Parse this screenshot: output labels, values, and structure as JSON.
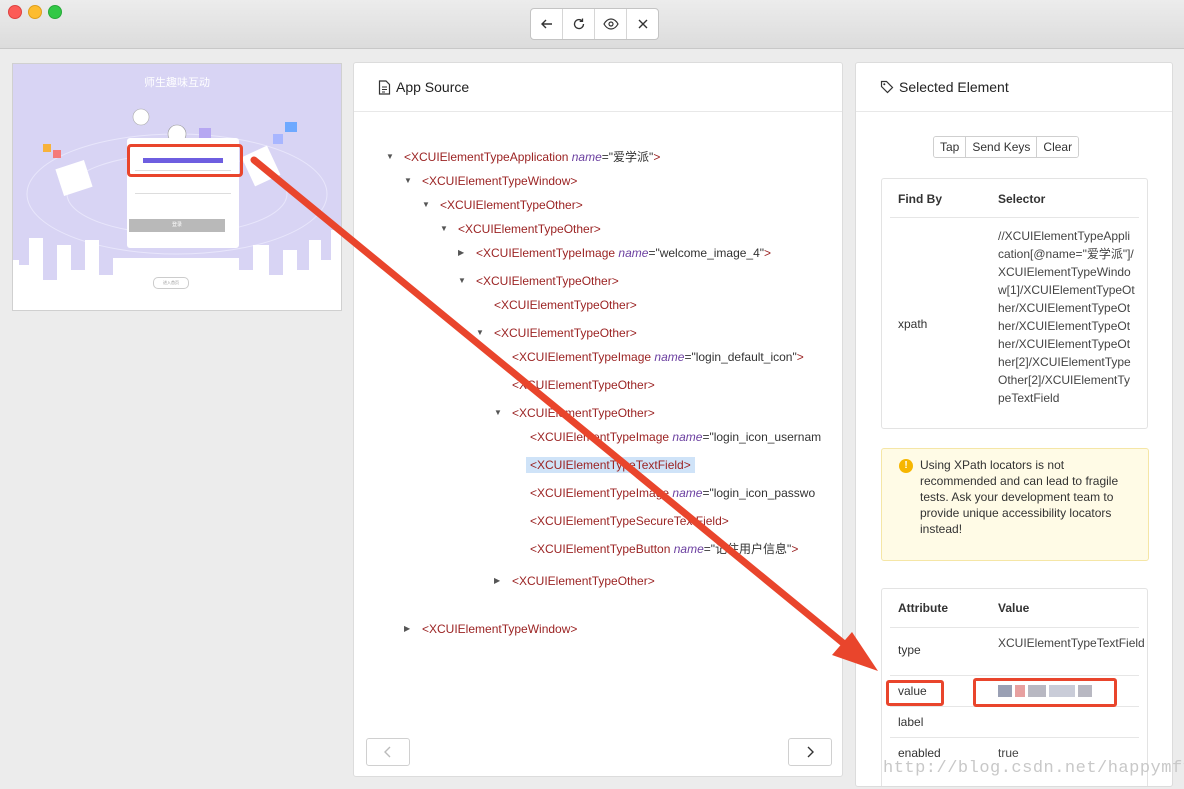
{
  "toolbar": {
    "buttons": [
      {
        "name": "back",
        "icon": "arrow-left-icon"
      },
      {
        "name": "refresh",
        "icon": "refresh-icon"
      },
      {
        "name": "inspect",
        "icon": "eye-icon"
      },
      {
        "name": "close",
        "icon": "close-icon"
      }
    ]
  },
  "screenshot": {
    "title": "师生趣味互动",
    "login_button": "登录",
    "footer_pill": "进入首页"
  },
  "source_panel": {
    "title": "App Source",
    "nodes": [
      {
        "tag": "<XCUIElementTypeApplication",
        "attr": "name",
        "value": "\"爱学派\"",
        "close": ">"
      },
      {
        "tag": "<XCUIElementTypeWindow>"
      },
      {
        "tag": "<XCUIElementTypeOther>"
      },
      {
        "tag": "<XCUIElementTypeOther>"
      },
      {
        "tag": "<XCUIElementTypeImage",
        "attr": "name",
        "value": "\"welcome_image_4\"",
        "close": ">"
      },
      {
        "tag": "<XCUIElementTypeOther>"
      },
      {
        "tag": "<XCUIElementTypeOther>"
      },
      {
        "tag": "<XCUIElementTypeOther>"
      },
      {
        "tag": "<XCUIElementTypeImage",
        "attr": "name",
        "value": "\"login_default_icon\"",
        "close": ">"
      },
      {
        "tag": "<XCUIElementTypeOther>"
      },
      {
        "tag": "<XCUIElementTypeOther>"
      },
      {
        "tag": "<XCUIElementTypeImage",
        "attr": "name",
        "value": "\"login_icon_usernam",
        "close": ""
      },
      {
        "tag": "<XCUIElementTypeTextField>"
      },
      {
        "tag": "<XCUIElementTypeImage",
        "attr": "name",
        "value": "\"login_icon_passwo",
        "close": ""
      },
      {
        "tag": "<XCUIElementTypeSecureTextField>"
      },
      {
        "tag": "<XCUIElementTypeButton",
        "attr": "name",
        "value": "\"记住用户信息\"",
        "close": ">"
      },
      {
        "tag": "<XCUIElementTypeOther>"
      },
      {
        "tag": "<XCUIElementTypeWindow>"
      }
    ]
  },
  "selected_panel": {
    "title": "Selected Element",
    "actions": [
      "Tap",
      "Send Keys",
      "Clear"
    ],
    "find_by_header": "Find By",
    "selector_header": "Selector",
    "find_by_key": "xpath",
    "xpath": "//XCUIElementTypeApplication[@name=\"爱学派\"]/XCUIElementTypeWindow[1]/XCUIElementTypeOther/XCUIElementTypeOther/XCUIElementTypeOther/XCUIElementTypeOther[2]/XCUIElementTypeOther[2]/XCUIElementTypeTextField",
    "warning": "Using XPath locators is not recommended and can lead to fragile tests. Ask your development team to provide unique accessibility locators instead!",
    "attr_header": "Attribute",
    "value_header": "Value",
    "attributes": [
      {
        "key": "type",
        "value": "XCUIElementTypeTextField"
      },
      {
        "key": "value",
        "value": ""
      },
      {
        "key": "label",
        "value": ""
      },
      {
        "key": "enabled",
        "value": "true"
      }
    ]
  },
  "watermark": "http://blog.csdn.net/happymff",
  "colors": {
    "annotation": "#e9452c",
    "tag": "#9b2323",
    "attr": "#6b3fa0",
    "selection": "#cfe3f8"
  }
}
